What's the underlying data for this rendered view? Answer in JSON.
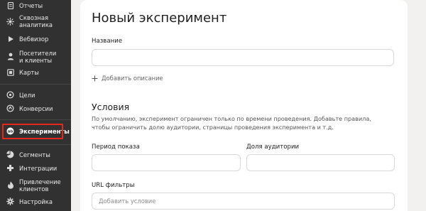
{
  "sidebar": {
    "items": [
      {
        "id": "reports",
        "label": "Отчеты",
        "icon": "reports-icon"
      },
      {
        "id": "end-to-end",
        "label": "Сквозная\nаналитика",
        "icon": "end-to-end-analytics-icon"
      },
      {
        "id": "webvisor",
        "label": "Вебвизор",
        "icon": "play-icon"
      },
      {
        "id": "visitors",
        "label": "Посетители\nи клиенты",
        "icon": "person-icon"
      },
      {
        "id": "maps",
        "label": "Карты",
        "icon": "map-icon"
      },
      {
        "id": "goals",
        "label": "Цели",
        "icon": "target-icon"
      },
      {
        "id": "conversions",
        "label": "Конверсии",
        "icon": "conversion-icon"
      },
      {
        "id": "experiments",
        "label": "Эксперименты",
        "icon": "ab-test-icon",
        "active": true
      },
      {
        "id": "segments",
        "label": "Сегменты",
        "icon": "segments-icon"
      },
      {
        "id": "integrations",
        "label": "Интеграции",
        "icon": "integrations-icon"
      },
      {
        "id": "acquisition",
        "label": "Привлечение\nклиентов",
        "icon": "flame-icon"
      },
      {
        "id": "settings",
        "label": "Настройка",
        "icon": "gear-icon"
      }
    ]
  },
  "form": {
    "title": "Новый эксперимент",
    "name_label": "Название",
    "name_value": "",
    "add_description": "Добавить описание",
    "conditions_title": "Условия",
    "conditions_desc": "По умолчанию, эксперимент ограничен только по времени проведения. Добавьте правила, чтобы ограничить долю аудитории, страницы проведения эксперимента и т.д.",
    "period_label": "Период показа",
    "period_value": "",
    "audience_label": "Доля аудитории",
    "audience_value": "",
    "url_filters_label": "URL фильтры",
    "add_condition_placeholder": "Добавить условие"
  },
  "colors": {
    "sidebar_bg": "#313131",
    "highlight": "#e5261b",
    "page_bg": "#f2f1ef",
    "card_bg": "#ffffff"
  }
}
